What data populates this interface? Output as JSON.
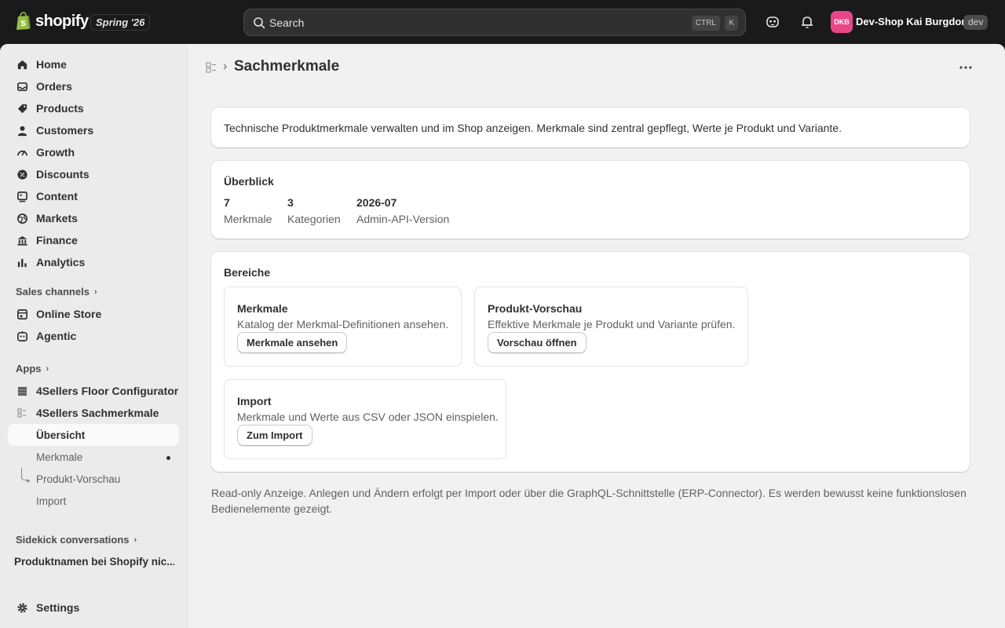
{
  "topbar": {
    "logo_text": "shopify",
    "edition": "Spring '26",
    "search_placeholder": "Search",
    "kbd_ctrl": "CTRL",
    "kbd_k": "K",
    "avatar_initials": "DKB",
    "shop_name": "Dev-Shop Kai Burgdorf",
    "env_badge": "dev",
    "colors": {
      "bar": "#1a1a1a",
      "avatar": "#e9468a"
    }
  },
  "sidebar": {
    "items": [
      {
        "label": "Home",
        "icon": "home-icon"
      },
      {
        "label": "Orders",
        "icon": "inbox-icon"
      },
      {
        "label": "Products",
        "icon": "tag-icon"
      },
      {
        "label": "Customers",
        "icon": "person-icon"
      },
      {
        "label": "Growth",
        "icon": "gauge-icon"
      },
      {
        "label": "Discounts",
        "icon": "discount-icon"
      },
      {
        "label": "Content",
        "icon": "content-icon"
      },
      {
        "label": "Markets",
        "icon": "globe-icon"
      },
      {
        "label": "Finance",
        "icon": "bank-icon"
      },
      {
        "label": "Analytics",
        "icon": "bar-chart-icon"
      }
    ],
    "sales_channels_title": "Sales channels",
    "channels": [
      {
        "label": "Online Store",
        "icon": "store-icon"
      },
      {
        "label": "Agentic",
        "icon": "agent-icon"
      }
    ],
    "apps_title": "Apps",
    "apps": [
      {
        "label": "4Sellers Floor Configurator",
        "icon": "app-floor-icon"
      },
      {
        "label": "4Sellers Sachmerkmale",
        "icon": "app-sachmerkmale-icon"
      }
    ],
    "app_subitems": [
      {
        "label": "Übersicht",
        "active": true
      },
      {
        "label": "Merkmale",
        "active": false
      },
      {
        "label": "Produkt-Vorschau",
        "active": false
      },
      {
        "label": "Import",
        "active": false
      }
    ],
    "sidekick_title": "Sidekick conversations",
    "conversations": [
      "Produktnamen bei Shopify nic..."
    ],
    "settings_label": "Settings"
  },
  "page": {
    "title": "Sachmerkmale",
    "intro": "Technische Produktmerkmale verwalten und im Shop anzeigen. Merkmale sind zentral gepflegt, Werte je Produkt und Variante.",
    "overview": {
      "title": "Überblick",
      "stats": [
        {
          "value": "7",
          "label": "Merkmale"
        },
        {
          "value": "3",
          "label": "Kategorien"
        },
        {
          "value": "2026-07",
          "label": "Admin-API-Version"
        }
      ]
    },
    "areas": {
      "title": "Bereiche",
      "cards": [
        {
          "title": "Merkmale",
          "desc": "Katalog der Merkmal-Definitionen ansehen.",
          "button": "Merkmale ansehen"
        },
        {
          "title": "Produkt-Vorschau",
          "desc": "Effektive Merkmale je Produkt und Variante prüfen.",
          "button": "Vorschau öffnen"
        },
        {
          "title": "Import",
          "desc": "Merkmale und Werte aus CSV oder JSON einspielen.",
          "button": "Zum Import"
        }
      ]
    },
    "footnote": "Read-only Anzeige. Anlegen und Ändern erfolgt per Import oder über die GraphQL-Schnittstelle (ERP-Connector). Es werden bewusst keine funktionslosen Bedienelemente gezeigt."
  }
}
